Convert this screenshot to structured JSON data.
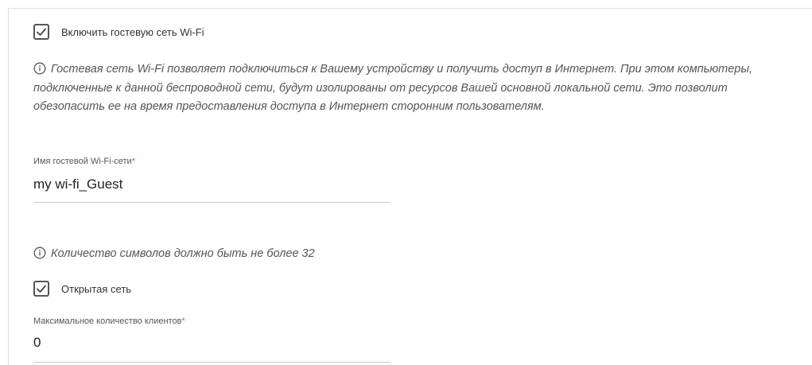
{
  "guest_wifi": {
    "enable_label": "Включить гостевую сеть Wi-Fi",
    "enable_checked": true,
    "info_text": "Гостевая сеть Wi-Fi позволяет подключиться к Вашему устройству и получить доступ в Интернет. При этом компьютеры, подключенные к данной беспроводной сети, будут изолированы от ресурсов Вашей основной локальной сети. Это позволит обезопасить ее на время предоставления доступа в Интернет сторонним пользователям.",
    "ssid_label": "Имя гостевой Wi-Fi-сети",
    "ssid_required_mark": "*",
    "ssid_value": "my wi-fi_Guest",
    "ssid_hint": "Количество символов должно быть не более 32",
    "open_network_label": "Открытая сеть",
    "open_network_checked": true,
    "max_clients_label": "Максимальное количество клиентов",
    "max_clients_required_mark": "*",
    "max_clients_value": "0"
  },
  "icons": {
    "checkbox_check": "checkmark-icon",
    "info": "info-circle-icon"
  },
  "colors": {
    "required": "#d9534f",
    "info_text": "#555555",
    "checkbox_border": "#555555"
  }
}
